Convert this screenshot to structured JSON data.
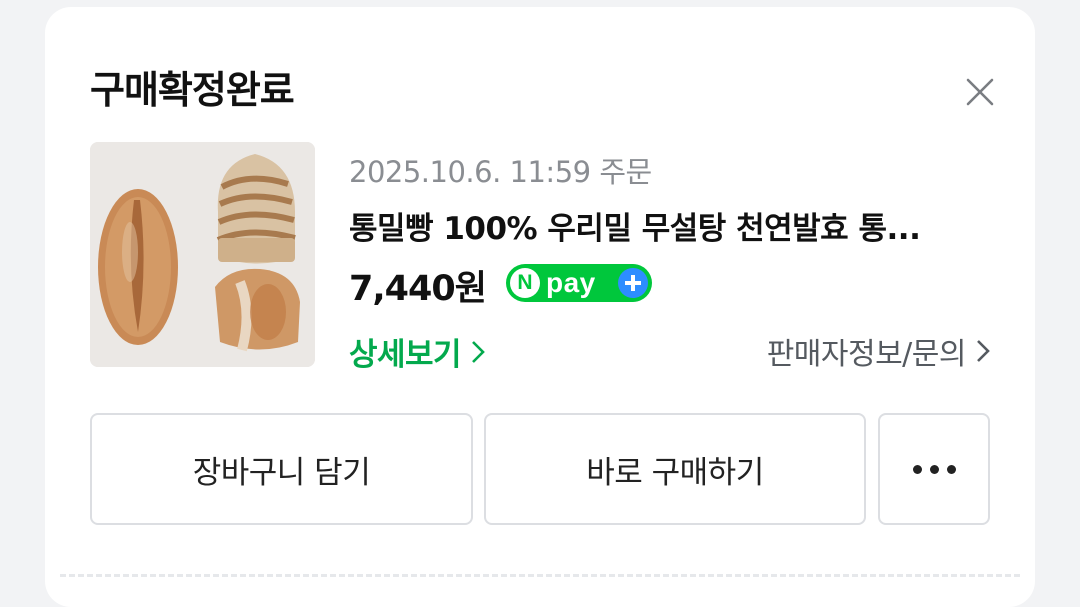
{
  "dialog": {
    "title": "구매확정완료",
    "close_icon": "close-icon"
  },
  "product": {
    "order_date": "2025.10.6. 11:59 주문",
    "name": "통밀빵 100% 우리밀 무설탕 천연발효 통...",
    "price": "7,440원",
    "thumbnail_icon": "bread-thumbnail"
  },
  "npay_badge": {
    "letter": "N",
    "label": "pay",
    "plus_icon": "plus-icon",
    "color": "#00c73c",
    "plus_color": "#2d8dff"
  },
  "links": {
    "detail_label": "상세보기",
    "seller_label": "판매자정보/문의",
    "detail_color": "#03a94d"
  },
  "actions": {
    "cart_label": "장바구니 담기",
    "buy_label": "바로 구매하기",
    "more_icon": "more-icon"
  }
}
